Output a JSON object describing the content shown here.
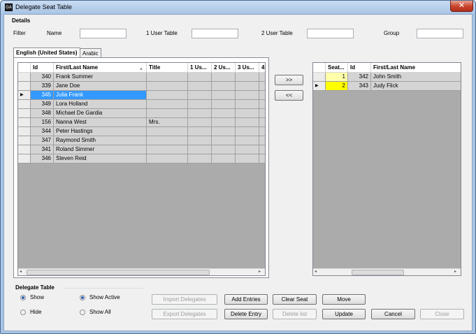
{
  "window": {
    "title": "Delegate Seat Table",
    "app_icon": "GA"
  },
  "details": {
    "heading": "Details",
    "filter_label": "Filter",
    "name_label": "Name",
    "user_table1_label": "1 User Table",
    "user_table2_label": "2 User Table",
    "group_label": "Group",
    "name_value": "",
    "user_table1_value": "",
    "user_table2_value": "",
    "group_value": ""
  },
  "tabs": [
    {
      "label": "English (United States)"
    },
    {
      "label": "Arabic"
    }
  ],
  "left_grid": {
    "headers": [
      "Id",
      "First/Last Name",
      "Title",
      "1 Us...",
      "2 Us...",
      "3 Us...",
      "4"
    ],
    "rows": [
      {
        "id": "340",
        "name": "Frank Summer",
        "title": ""
      },
      {
        "id": "339",
        "name": "Jane Doe",
        "title": ""
      },
      {
        "id": "345",
        "name": "Julia  Frank",
        "title": ""
      },
      {
        "id": "349",
        "name": "Lora Holland",
        "title": ""
      },
      {
        "id": "348",
        "name": "Michael De Gardia",
        "title": ""
      },
      {
        "id": "156",
        "name": "Nanna West",
        "title": "Mrs."
      },
      {
        "id": "344",
        "name": "Peter Hastings",
        "title": ""
      },
      {
        "id": "347",
        "name": "Raymond Smith",
        "title": ""
      },
      {
        "id": "341",
        "name": "Roland  Simmer",
        "title": ""
      },
      {
        "id": "346",
        "name": "Steven Reid",
        "title": ""
      }
    ],
    "selected_row": 2
  },
  "transfer": {
    "add_label": ">>",
    "remove_label": "<<"
  },
  "right_grid": {
    "headers": [
      "Seat...",
      "Id",
      "First/Last Name"
    ],
    "rows": [
      {
        "seat": "1",
        "id": "342",
        "name": "John Smith"
      },
      {
        "seat": "2",
        "id": "343",
        "name": "Judy Flick"
      }
    ]
  },
  "delegate_table": {
    "heading": "Delegate Table",
    "show_label": "Show",
    "hide_label": "Hide",
    "show_active_label": "Show Active",
    "show_all_label": "Show All"
  },
  "buttons": {
    "import": "Import Delegates",
    "export": "Export Delegates",
    "add_entries": "Add Entries",
    "delete_entry": "Delete Entry",
    "clear_seat": "Clear Seat",
    "delete_list": "Delete list",
    "move": "Move",
    "update": "Update",
    "cancel": "Cancel",
    "close": "Close"
  },
  "colors": {
    "selection": "#3399ff",
    "seat_highlight": "#ffff00",
    "grid_background": "#ababab"
  }
}
